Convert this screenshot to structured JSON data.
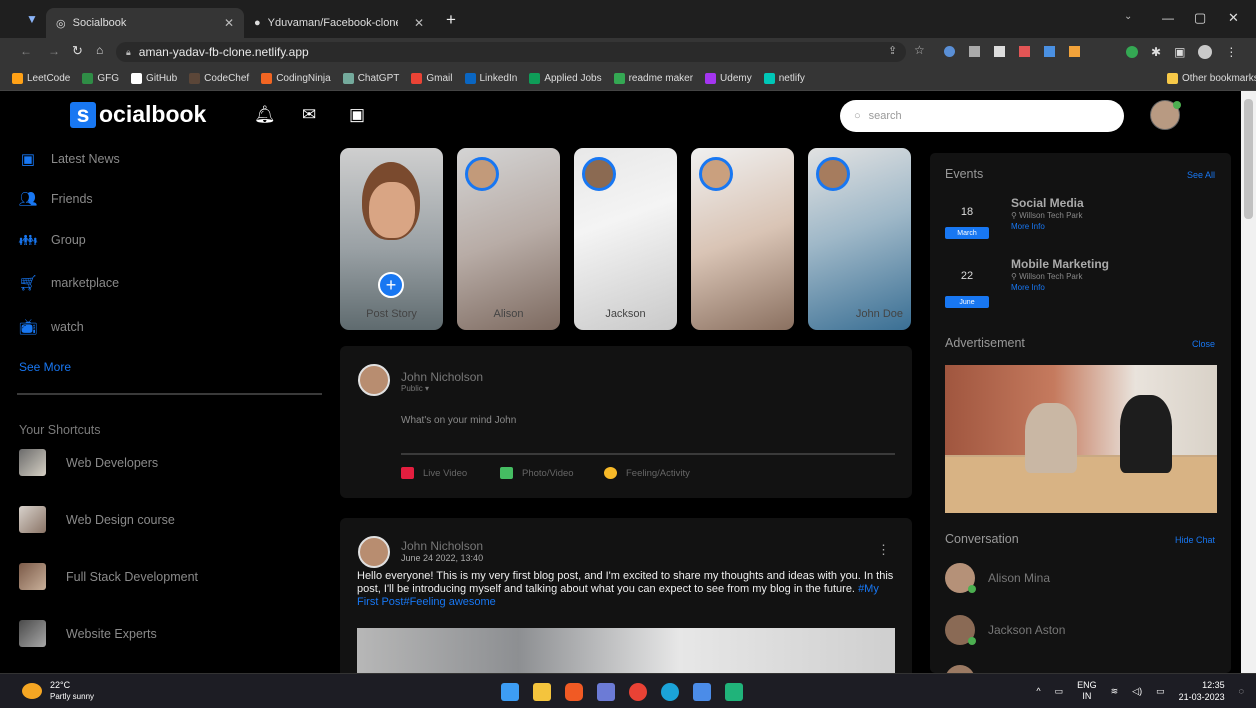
{
  "browser": {
    "tabs": [
      {
        "title": "Socialbook",
        "active": true
      },
      {
        "title": "Yduvaman/Facebook-clone: You",
        "active": false
      }
    ],
    "new_tab_icon": "+",
    "url": "aman-yadav-fb-clone.netlify.app",
    "bookmarks": [
      {
        "label": "LeetCode",
        "color": "#ffa116"
      },
      {
        "label": "GFG",
        "color": "#2f8d46"
      },
      {
        "label": "GitHub",
        "color": "#ffffff"
      },
      {
        "label": "CodeChef",
        "color": "#5b4638"
      },
      {
        "label": "CodingNinja",
        "color": "#f26522"
      },
      {
        "label": "ChatGPT",
        "color": "#74aa9c"
      },
      {
        "label": "Gmail",
        "color": "#ea4335"
      },
      {
        "label": "LinkedIn",
        "color": "#0a66c2"
      },
      {
        "label": "Applied Jobs",
        "color": "#0f9d58"
      },
      {
        "label": "readme maker",
        "color": "#34a853"
      },
      {
        "label": "Udemy",
        "color": "#a435f0"
      },
      {
        "label": "netlify",
        "color": "#00c7b7"
      }
    ],
    "other_bookmarks": "Other bookmarks"
  },
  "site": {
    "logo_letter": "s",
    "logo_rest": "ocialbook",
    "nav_icons": [
      "bell-icon",
      "mail-icon",
      "video-icon"
    ],
    "search_placeholder": "search",
    "accent": "#1877f2"
  },
  "sidebar": {
    "items": [
      {
        "label": "Latest News",
        "icon": "news-icon"
      },
      {
        "label": "Friends",
        "icon": "friends-icon"
      },
      {
        "label": "Group",
        "icon": "group-icon"
      },
      {
        "label": "marketplace",
        "icon": "cart-icon"
      },
      {
        "label": "watch",
        "icon": "tv-icon"
      }
    ],
    "see_more": "See More",
    "shortcuts_title": "Your Shortcuts",
    "shortcuts": [
      {
        "label": "Web Developers"
      },
      {
        "label": "Web Design course"
      },
      {
        "label": "Full Stack Development"
      },
      {
        "label": "Website Experts"
      }
    ]
  },
  "stories": [
    {
      "name": "Post Story",
      "is_add": true
    },
    {
      "name": "Alison"
    },
    {
      "name": "Jackson"
    },
    {
      "name": ""
    },
    {
      "name": "John Doe"
    }
  ],
  "composer": {
    "user": "John Nicholson",
    "privacy": "Public",
    "prompt": "What's on your mind John",
    "actions": [
      {
        "label": "Live Video",
        "color": "#e41e3f"
      },
      {
        "label": "Photo/Video",
        "color": "#45bd62"
      },
      {
        "label": "Feeling/Activity",
        "color": "#f7b928"
      }
    ]
  },
  "post": {
    "user": "John Nicholson",
    "date": "June 24 2022, 13:40",
    "text": "Hello everyone! This is my very first blog post, and I'm excited to share my thoughts and ideas with you. In this post, I'll be introducing myself and talking about what you can expect to see from my blog in the future.",
    "tags": "#My First Post#Feeling awesome"
  },
  "right": {
    "events_title": "Events",
    "events_link": "See All",
    "events": [
      {
        "day": "18",
        "month": "March",
        "title": "Social Media",
        "location": "Willson Tech Park",
        "more": "More Info"
      },
      {
        "day": "22",
        "month": "June",
        "title": "Mobile Marketing",
        "location": "Willson Tech Park",
        "more": "More Info"
      }
    ],
    "ad_title": "Advertisement",
    "ad_link": "Close",
    "conv_title": "Conversation",
    "conv_link": "Hide Chat",
    "contacts": [
      {
        "name": "Alison Mina"
      },
      {
        "name": "Jackson Aston"
      }
    ]
  },
  "taskbar": {
    "temp": "22°C",
    "weather": "Partly sunny",
    "lang": "ENG",
    "region": "IN",
    "time": "12:35",
    "date": "21-03-2023"
  }
}
